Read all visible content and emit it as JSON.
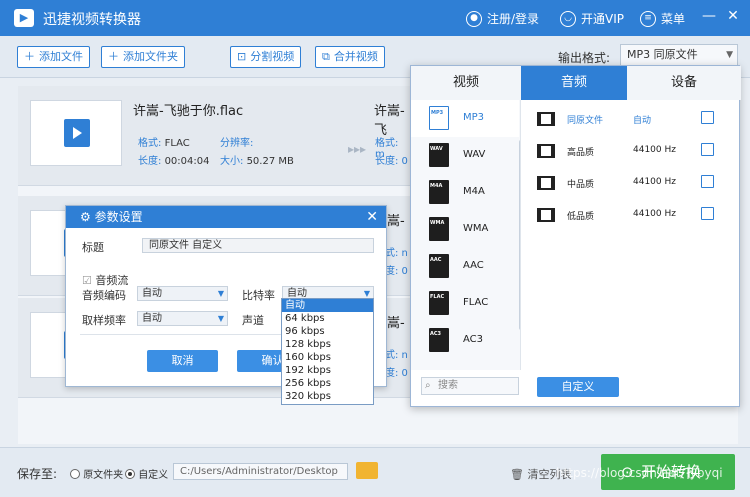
{
  "app": {
    "title": "迅捷视频转换器",
    "login": "注册/登录",
    "vip": "开通VIP",
    "menu": "菜单"
  },
  "toolbar": {
    "add_file": "添加文件",
    "add_folder": "添加文件夹",
    "split": "分割视频",
    "merge": "合并视频",
    "format_label": "输出格式:",
    "format_value": "MP3  同原文件"
  },
  "files": [
    {
      "name": "许嵩-飞驰于你.flac",
      "format_k": "格式:",
      "format_v": "FLAC",
      "res_k": "分辨率:",
      "res_v": "",
      "dur_k": "长度:",
      "dur_v": "00:04:04",
      "size_k": "大小:",
      "size_v": "50.27 MB",
      "out_name": "许嵩-飞",
      "out_r1": "格式: m",
      "out_r2": "长度: 0"
    },
    {
      "out_name": "许嵩-飞",
      "out_r1": "格式: n",
      "out_r2": "长度: 0"
    },
    {
      "out_name": "许嵩-飞",
      "out_r1": "格式: n",
      "out_r2": "长度: 0"
    }
  ],
  "dialog": {
    "title": "参数设置",
    "label_title": "标题",
    "title_value": "同原文件 自定义",
    "audio_stream": "音频流",
    "codec_label": "音频编码",
    "codec_value": "自动",
    "bitrate_label": "比特率",
    "bitrate_value": "自动",
    "sample_label": "取样频率",
    "sample_value": "自动",
    "channel_label": "声道",
    "cancel": "取消",
    "ok": "确认"
  },
  "bitrate_options": [
    "自动",
    "64 kbps",
    "96 kbps",
    "128 kbps",
    "160 kbps",
    "192 kbps",
    "256 kbps",
    "320 kbps"
  ],
  "panel": {
    "tabs": [
      "视频",
      "音频",
      "设备"
    ],
    "formats": [
      {
        "icon": "MP3",
        "name": "MP3"
      },
      {
        "icon": "WAV",
        "name": "WAV"
      },
      {
        "icon": "M4A",
        "name": "M4A"
      },
      {
        "icon": "WMA",
        "name": "WMA"
      },
      {
        "icon": "AAC",
        "name": "AAC"
      },
      {
        "icon": "FLAC",
        "name": "FLAC"
      },
      {
        "icon": "AC3",
        "name": "AC3"
      }
    ],
    "qualities": [
      {
        "name": "同原文件",
        "value": "自动"
      },
      {
        "name": "高品质",
        "value": "44100 Hz"
      },
      {
        "name": "中品质",
        "value": "44100 Hz"
      },
      {
        "name": "低品质",
        "value": "44100 Hz"
      }
    ],
    "search_placeholder": "搜索",
    "custom": "自定义"
  },
  "bottom": {
    "save_to": "保存至:",
    "opt_source": "原文件夹",
    "opt_custom": "自定义",
    "path": "C:/Users/Administrator/Desktop",
    "clear": "清空列表",
    "start": "开始转换"
  },
  "watermark": "https://blog.csdn.net/Tybyqi",
  "colors": {
    "accent": "#2f7fd5",
    "start": "#3fb34f"
  }
}
